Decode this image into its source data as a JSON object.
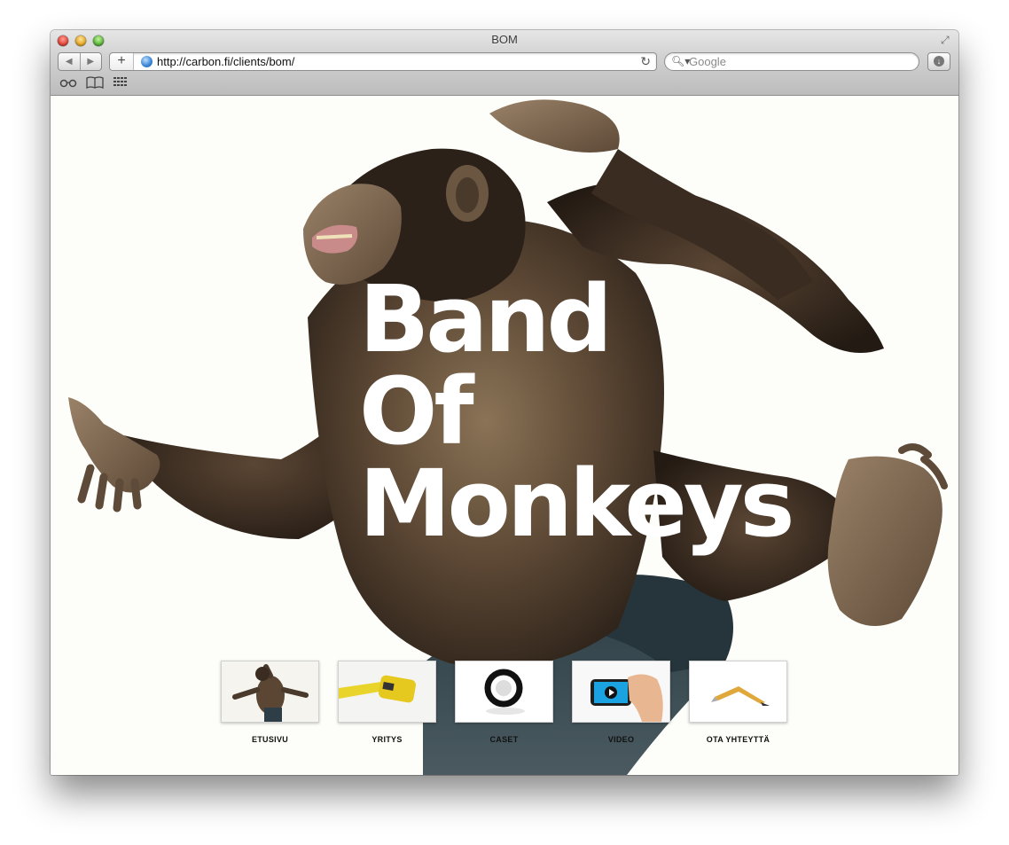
{
  "window": {
    "title": "BOM"
  },
  "toolbar": {
    "url": "http://carbon.fi/clients/bom/",
    "search_placeholder": "Google"
  },
  "page": {
    "hero_lines": [
      "Band",
      "Of",
      "Monkeys"
    ],
    "nav": [
      {
        "label": "ETUSIVU",
        "icon": "monkey-thumbnail"
      },
      {
        "label": "YRITYS",
        "icon": "tape-measure-thumbnail"
      },
      {
        "label": "CASET",
        "icon": "ring-thumbnail"
      },
      {
        "label": "VIDEO",
        "icon": "phone-video-thumbnail"
      },
      {
        "label": "OTA YHTEYTTÄ",
        "icon": "pencil-thumbnail"
      }
    ]
  },
  "colors": {
    "background": "#fdfdf9",
    "hero_text": "#ffffff",
    "fur": "#3b2d22"
  }
}
